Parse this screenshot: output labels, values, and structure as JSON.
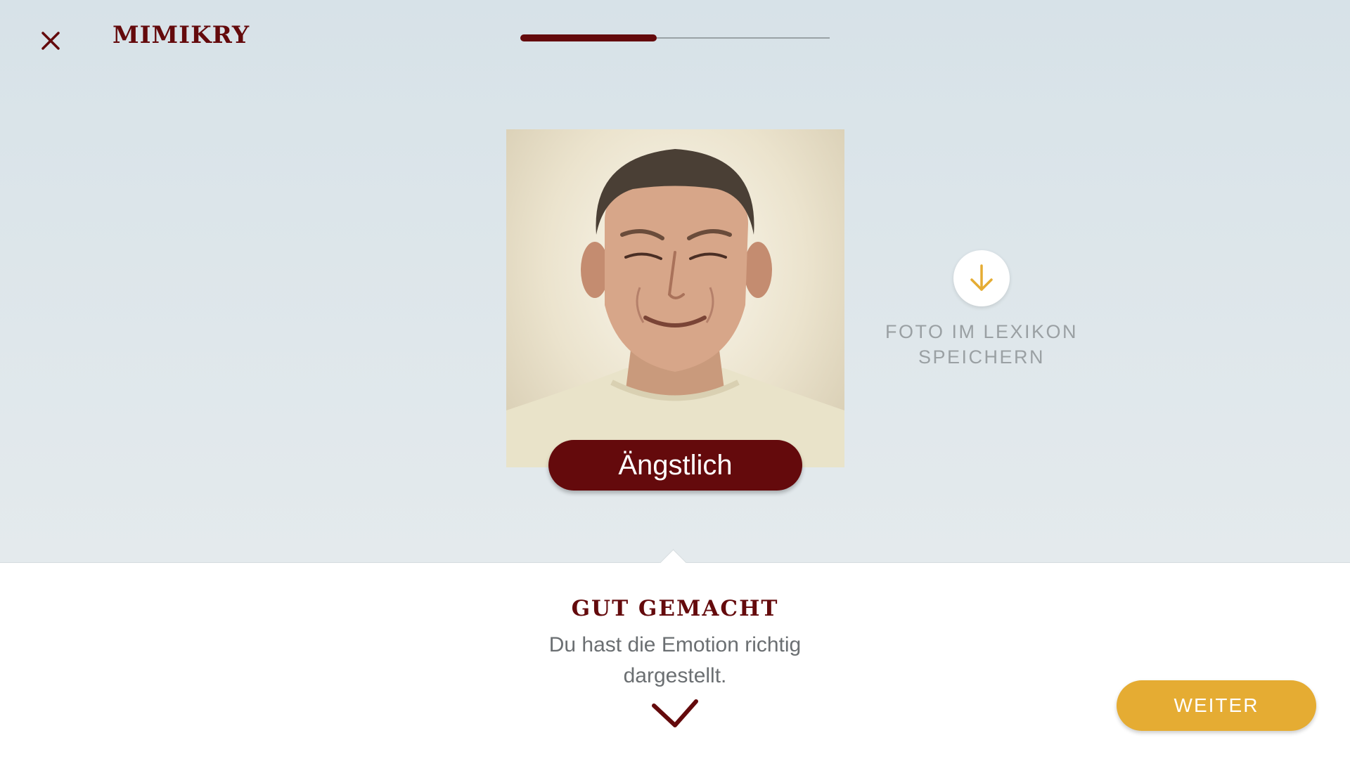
{
  "header": {
    "app_title": "MIMIKRY",
    "close_icon": "close-icon",
    "progress_fraction": 0.44
  },
  "photo": {
    "emotion_label": "Ängstlich"
  },
  "save_action": {
    "icon": "arrow-down-icon",
    "label_line1": "FOTO IM LEXIKON",
    "label_line2": "SPEICHERN"
  },
  "feedback": {
    "title": "GUT GEMACHT",
    "text_line1": "Du hast die Emotion richtig",
    "text_line2": "dargestellt.",
    "icon": "checkmark-icon"
  },
  "footer": {
    "next_label": "WEITER"
  },
  "colors": {
    "brand_dark_red": "#640a0c",
    "accent_yellow": "#e5ac33",
    "background_top": "#d7e2e8",
    "muted_text": "#9aa0a3"
  }
}
